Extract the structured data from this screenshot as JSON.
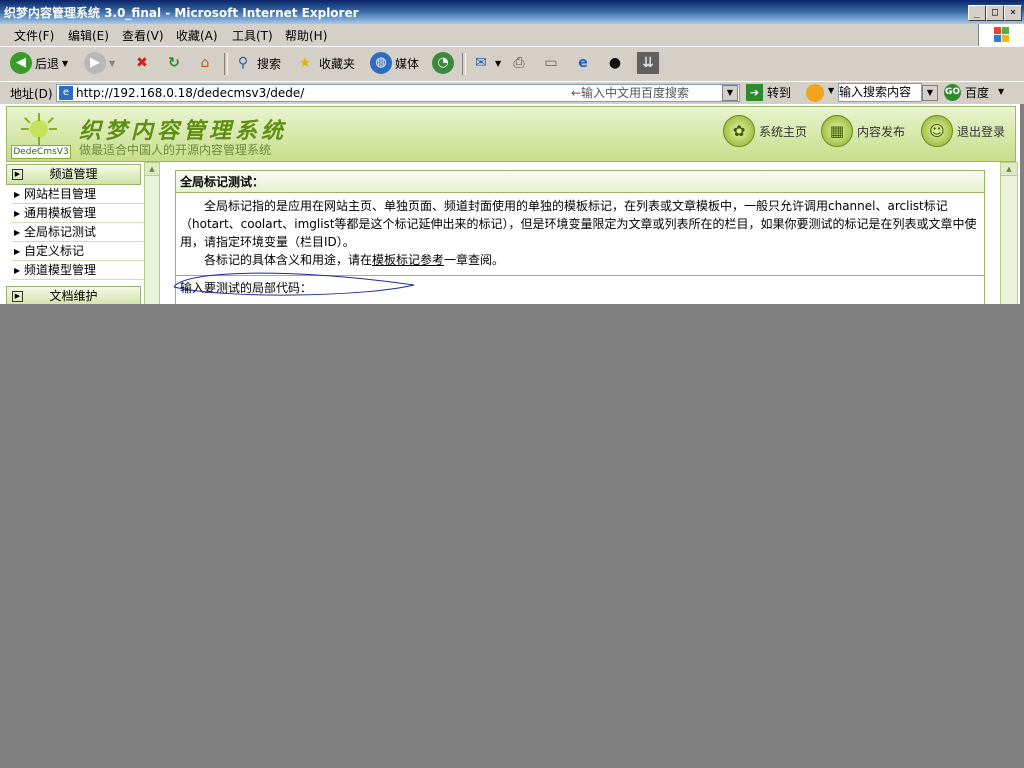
{
  "window": {
    "title": "织梦内容管理系统 3.0_final - Microsoft Internet Explorer",
    "minimize": "_",
    "maximize": "□",
    "close": "×"
  },
  "menu": {
    "items": [
      "文件(F)",
      "编辑(E)",
      "查看(V)",
      "收藏(A)",
      "工具(T)",
      "帮助(H)"
    ]
  },
  "toolbar": {
    "back": "后退",
    "search": "搜索",
    "favorites": "收藏夹",
    "media": "媒体"
  },
  "address": {
    "label": "地址(D)",
    "url": "http://192.168.0.18/dedecmsv3/dede/",
    "baidu_placeholder": "←输入中文用百度搜索",
    "go": "转到",
    "search_box": "输入搜索内容",
    "baidu": "百度"
  },
  "banner": {
    "logo_caption": "DedeCmsV3",
    "brand_title": "织梦内容管理系统",
    "slogan": "做最适合中国人的开源内容管理系统",
    "nav": [
      {
        "label": "系统主页",
        "icon": "paw-icon"
      },
      {
        "label": "内容发布",
        "icon": "grid-icon"
      },
      {
        "label": "退出登录",
        "icon": "person-icon"
      }
    ]
  },
  "sidebar": {
    "section1": "频道管理",
    "items": [
      "网站栏目管理",
      "通用模板管理",
      "全局标记测试",
      "自定义标记",
      "频道模型管理"
    ],
    "section2": "文档维护"
  },
  "content": {
    "title": "全局标记测试：",
    "paragraph1": "全局标记指的是应用在网站主页、单独页面、频道封面使用的单独的模板标记，在列表或文章模板中，一般只允许调用channel、arclist标记（hotart、coolart、imglist等都是这个标记延伸出来的标记），但是环境变量限定为文章或列表所在的栏目，如果你要测试的标记是在列表或文章中使用，请指定环境变量（栏目ID）。",
    "paragraph2_before": "各标记的具体含义和用途，请在",
    "paragraph2_link": "模板标记参考",
    "paragraph2_after": "一章查阅。",
    "code_label": "输入要测试的局部代码："
  },
  "colors": {
    "banner_green": "#c7de8a",
    "desktop_gray": "#808080",
    "titlebar_blue": "#0a246a"
  }
}
